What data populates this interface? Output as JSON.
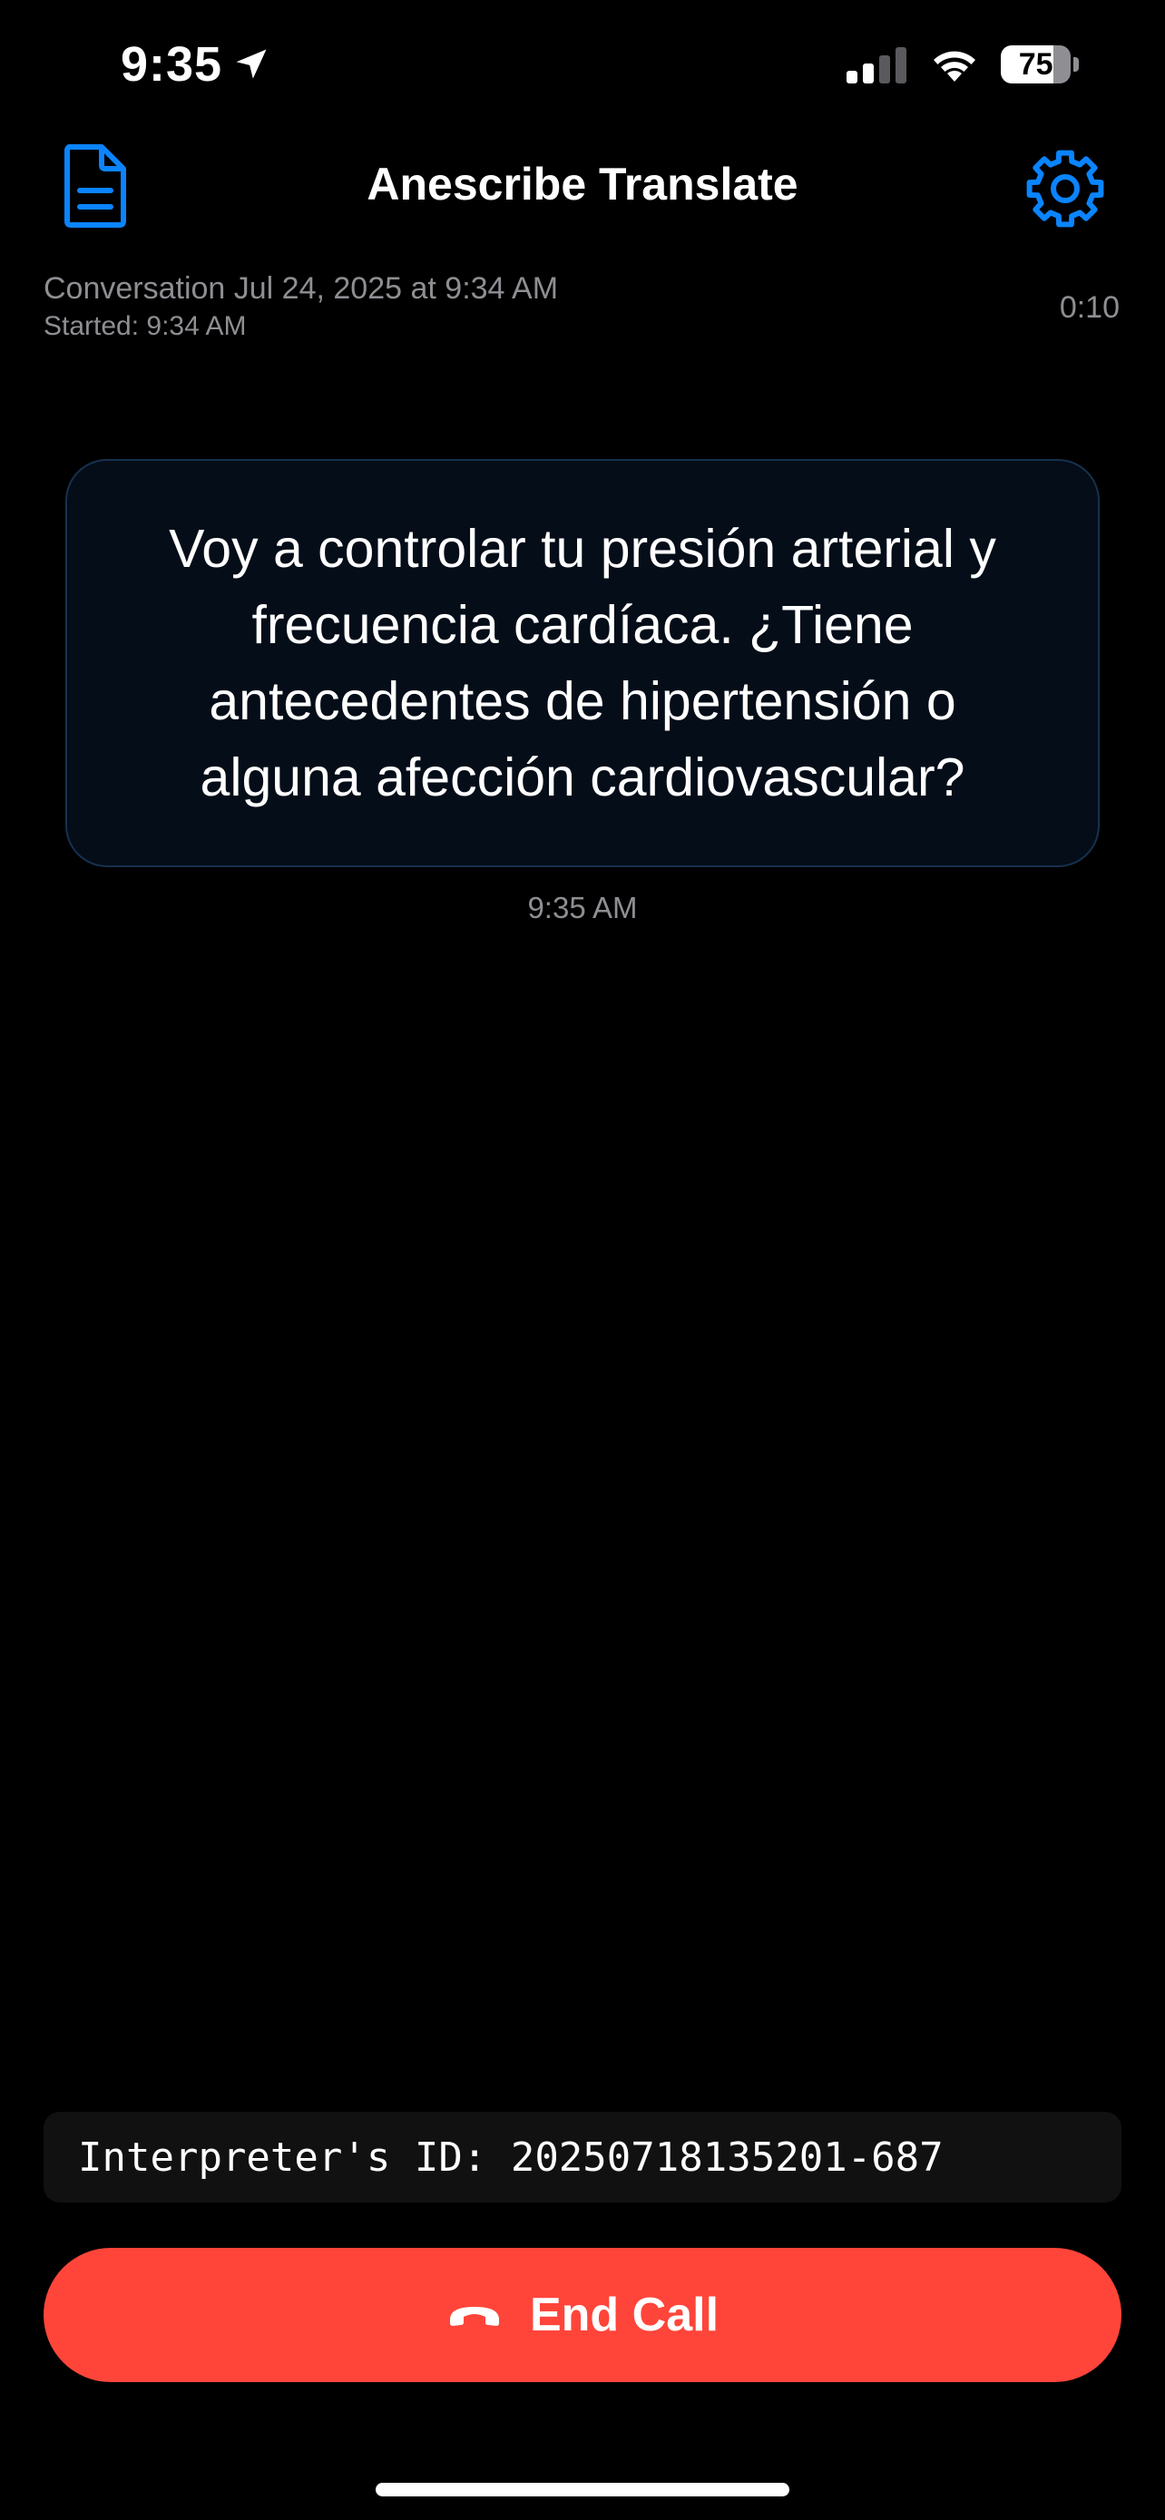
{
  "status_bar": {
    "time": "9:35",
    "battery_level": "75",
    "battery_fraction": 0.75
  },
  "header": {
    "title": "Anescribe Translate",
    "left_icon": "document-icon",
    "right_icon": "gear-icon"
  },
  "conversation": {
    "title": "Conversation Jul 24, 2025 at 9:34 AM",
    "started": "Started: 9:34 AM",
    "elapsed": "0:10"
  },
  "messages": [
    {
      "text": "Voy a controlar tu presión arterial y frecuencia cardíaca. ¿Tiene antecedentes de hipertensión o alguna afección cardiovascular?",
      "time": "9:35 AM"
    }
  ],
  "interpreter": {
    "id_text": "Interpreter's ID: 20250718135201-687"
  },
  "actions": {
    "end_call_label": "End Call",
    "end_call_icon": "phone-hangup-icon"
  },
  "colors": {
    "accent": "#0a84ff",
    "danger": "#ff453a",
    "background": "#000000",
    "bubble_background": "#040d18",
    "secondary_text": "#8e8e93"
  }
}
